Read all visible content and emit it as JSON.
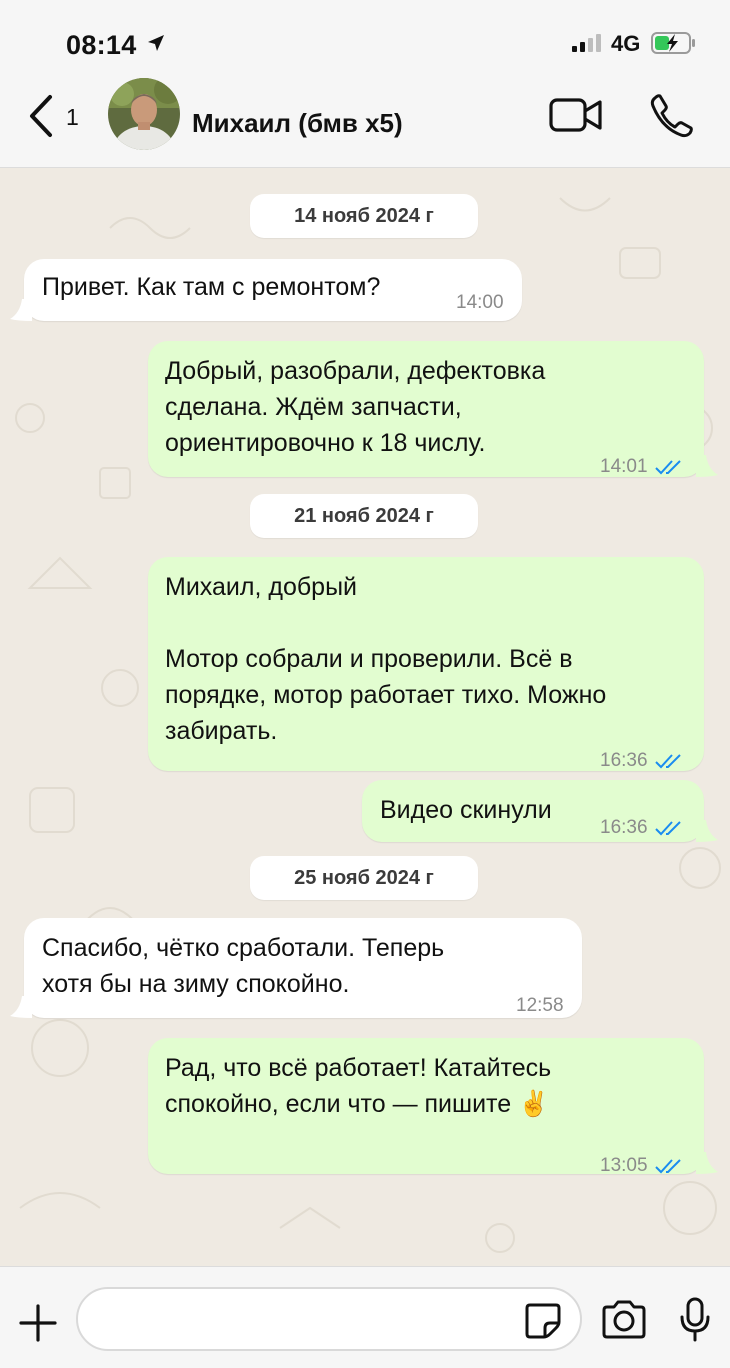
{
  "status_bar": {
    "time": "08:14",
    "network": "4G",
    "icons": [
      "location-arrow-icon",
      "signal-icon",
      "battery-charging-icon"
    ]
  },
  "header": {
    "back_count": "1",
    "contact_name": "Михаил (бмв х5)",
    "icons": [
      "back-chevron-icon",
      "video-call-icon",
      "phone-icon"
    ]
  },
  "chat": {
    "dates": [
      "14 нояб 2024 г",
      "21 нояб 2024 г",
      "25 нояб 2024 г"
    ],
    "messages": [
      {
        "direction": "in",
        "text": "Привет. Как там с ремонтом?",
        "time": "14:00"
      },
      {
        "direction": "out",
        "text": "Добрый, разобрали, дефектовка\nсделана. Ждём запчасти,\nориентировочно к 18 числу.",
        "time": "14:01",
        "read": true
      },
      {
        "direction": "out",
        "text": "Михаил, добрый\n\nМотор собрали и проверили. Всё в\nпорядке, мотор работает тихо. Можно\nзабирать.",
        "time": "16:36",
        "read": true
      },
      {
        "direction": "out",
        "text": "Видео скинули",
        "time": "16:36",
        "read": true
      },
      {
        "direction": "in",
        "text": "Спасибо, чётко сработали. Теперь\nхотя бы на зиму спокойно.",
        "time": "12:58"
      },
      {
        "direction": "out",
        "text": "Рад, что всё работает! Катайтесь\nспокойно, если что — пишите ✌️",
        "time": "13:05",
        "read": true
      }
    ],
    "colors": {
      "incoming": "#ffffff",
      "outgoing": "#e2fdd0",
      "read_ticks": "#1a8cf0"
    }
  },
  "input_bar": {
    "placeholder": "",
    "icons": [
      "plus-icon",
      "sticker-icon",
      "camera-icon",
      "microphone-icon"
    ]
  }
}
